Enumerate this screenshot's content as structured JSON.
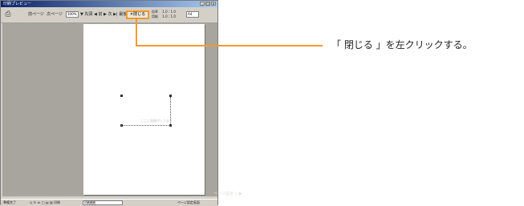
{
  "window": {
    "title": "印刷プレビュー",
    "controls": [
      "_",
      "□",
      "×"
    ]
  },
  "toolbar": {
    "print_icon": "printer-icon",
    "prev_page": "前ページ",
    "next_page": "次ページ",
    "zoom_value": "100%",
    "nav_items": "▼ 先頭 ◀ 前 ▶ 次 ▶| 最後",
    "close_label": "✕閉じる",
    "zoom_info_1": "倍率　 1.0 : 1.0",
    "zoom_info_2": "用紙　 1.0 : 1.0",
    "zoom_field": "A4"
  },
  "statusbar": {
    "left": "準備完了",
    "tools": "◎ ↻ ≫ □ ▤ ▥ 印刷",
    "field": "印刷範囲",
    "right": "ページ設定画面"
  },
  "page": {
    "faint_label": "ここに画像が入ります"
  },
  "corner": "ページ設定 ◇ ▶",
  "callout": {
    "text": "「 閉じる 」を左クリックする。",
    "color": "#f29a2e"
  }
}
